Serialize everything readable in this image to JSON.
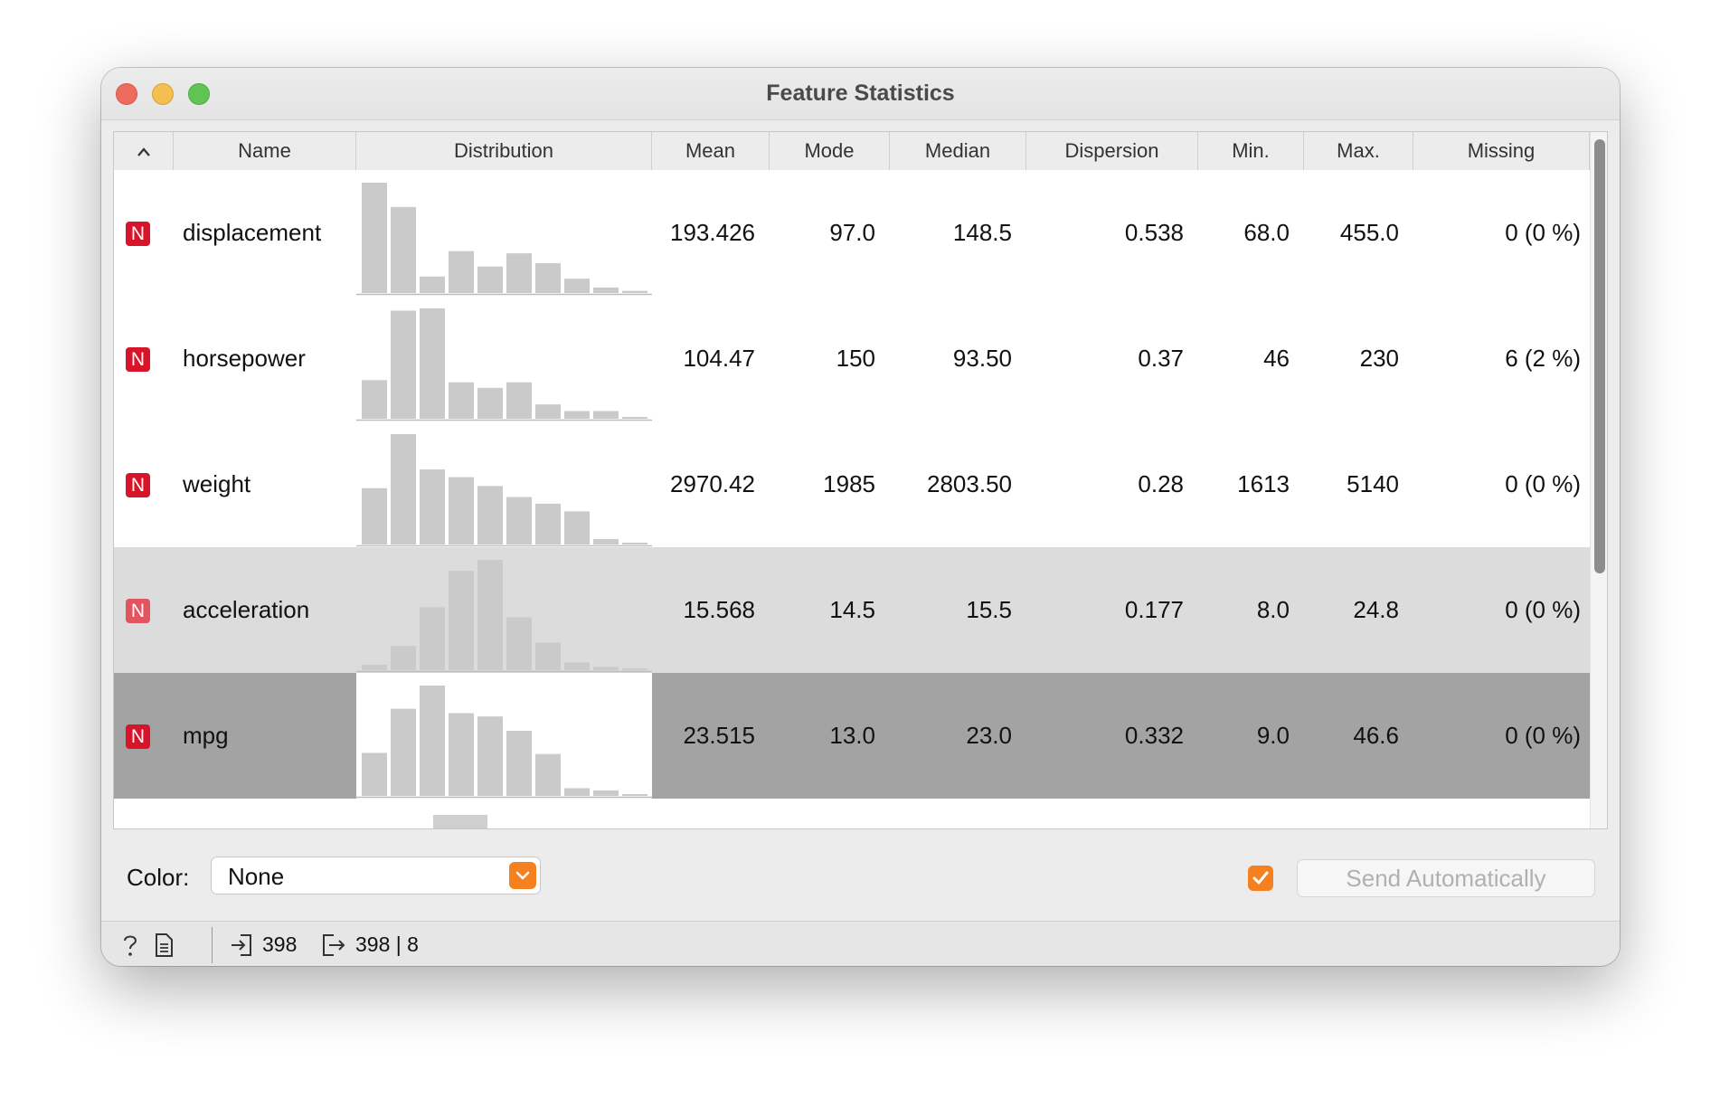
{
  "window": {
    "title": "Feature Statistics"
  },
  "table": {
    "columns": {
      "name": "Name",
      "distribution": "Distribution",
      "mean": "Mean",
      "mode": "Mode",
      "median": "Median",
      "dispersion": "Dispersion",
      "min": "Min.",
      "max": "Max.",
      "missing": "Missing"
    },
    "sort_indicator": "^",
    "rows": [
      {
        "type": "N",
        "name": "displacement",
        "mean": "193.426",
        "mode": "97.0",
        "median": "148.5",
        "dispersion": "0.538",
        "min": "68.0",
        "max": "455.0",
        "missing": "0 (0 %)",
        "state": "normal",
        "histogram": [
          1.0,
          0.78,
          0.15,
          0.38,
          0.24,
          0.36,
          0.27,
          0.13,
          0.05,
          0.02
        ]
      },
      {
        "type": "N",
        "name": "horsepower",
        "mean": "104.47",
        "mode": "150",
        "median": "93.50",
        "dispersion": "0.37",
        "min": "46",
        "max": "230",
        "missing": "6 (2 %)",
        "state": "normal",
        "histogram": [
          0.35,
          0.98,
          1.0,
          0.33,
          0.28,
          0.33,
          0.13,
          0.07,
          0.07,
          0.01
        ]
      },
      {
        "type": "N",
        "name": "weight",
        "mean": "2970.42",
        "mode": "1985",
        "median": "2803.50",
        "dispersion": "0.28",
        "min": "1613",
        "max": "5140",
        "missing": "0 (0 %)",
        "state": "normal",
        "histogram": [
          0.51,
          1.0,
          0.68,
          0.61,
          0.53,
          0.43,
          0.37,
          0.3,
          0.05,
          0.01
        ]
      },
      {
        "type": "N",
        "name": "acceleration",
        "mean": "15.568",
        "mode": "14.5",
        "median": "15.5",
        "dispersion": "0.177",
        "min": "8.0",
        "max": "24.8",
        "missing": "0 (0 %)",
        "state": "hover",
        "histogram": [
          0.05,
          0.22,
          0.57,
          0.9,
          1.0,
          0.48,
          0.25,
          0.07,
          0.03,
          0.01
        ]
      },
      {
        "type": "N",
        "name": "mpg",
        "mean": "23.515",
        "mode": "13.0",
        "median": "23.0",
        "dispersion": "0.332",
        "min": "9.0",
        "max": "46.6",
        "missing": "0 (0 %)",
        "state": "selected",
        "histogram": [
          0.39,
          0.79,
          1.0,
          0.75,
          0.72,
          0.59,
          0.38,
          0.07,
          0.05,
          0.01
        ]
      }
    ]
  },
  "controls": {
    "color_label": "Color:",
    "color_value": "None",
    "auto_send_checked": true,
    "send_label": "Send Automatically"
  },
  "status": {
    "input_count": "398",
    "output_count": "398 | 8"
  },
  "colors": {
    "numeric_badge": "#d7142a",
    "accent": "#f4801f",
    "selected_row": "#a3a3a3",
    "hover_row": "#dcdcdc",
    "histogram_bar": "#cacaca"
  }
}
